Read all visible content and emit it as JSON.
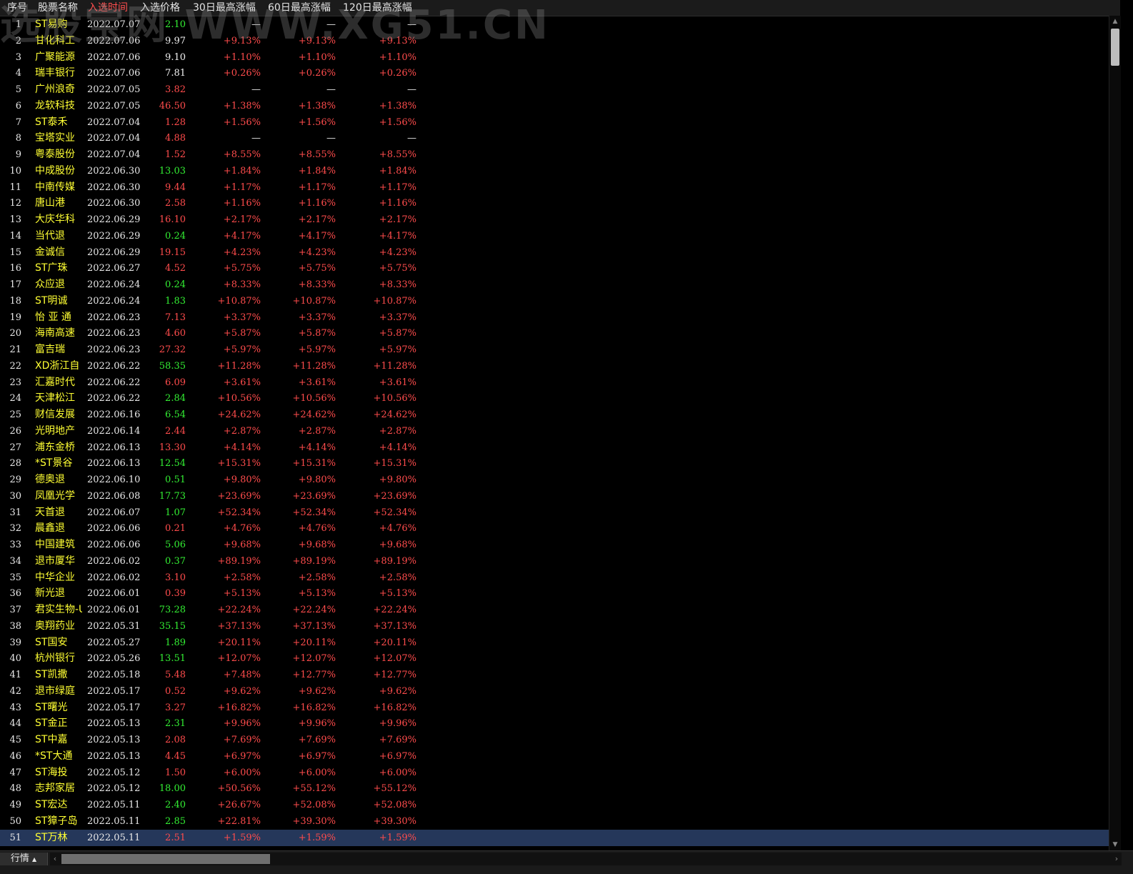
{
  "header": {
    "columns": [
      "序号",
      "股票名称",
      "入选时间",
      "入选价格",
      "30日最高涨幅",
      "60日最高涨幅",
      "120日最高涨幅"
    ],
    "active_column": "入选时间"
  },
  "watermark": "选股宝网 WWW.XG51.CN",
  "colors": {
    "up": "#ff4c4c",
    "down": "#33ee33",
    "name": "#ffff33",
    "selected_row": "#25375a"
  },
  "rows": [
    {
      "seq": "1",
      "name": "ST易购",
      "date": "2022.07.07",
      "price": "2.10",
      "pc": "green",
      "g30": "—",
      "g60": "—",
      "g120": "—"
    },
    {
      "seq": "2",
      "name": "甘化科工",
      "date": "2022.07.06",
      "price": "9.97",
      "pc": "white",
      "g30": "+9.13%",
      "g60": "+9.13%",
      "g120": "+9.13%"
    },
    {
      "seq": "3",
      "name": "广聚能源",
      "date": "2022.07.06",
      "price": "9.10",
      "pc": "white",
      "g30": "+1.10%",
      "g60": "+1.10%",
      "g120": "+1.10%"
    },
    {
      "seq": "4",
      "name": "瑞丰银行",
      "date": "2022.07.06",
      "price": "7.81",
      "pc": "white",
      "g30": "+0.26%",
      "g60": "+0.26%",
      "g120": "+0.26%"
    },
    {
      "seq": "5",
      "name": "广州浪奇",
      "date": "2022.07.05",
      "price": "3.82",
      "pc": "red",
      "g30": "—",
      "g60": "—",
      "g120": "—"
    },
    {
      "seq": "6",
      "name": "龙软科技",
      "date": "2022.07.05",
      "price": "46.50",
      "pc": "red",
      "g30": "+1.38%",
      "g60": "+1.38%",
      "g120": "+1.38%"
    },
    {
      "seq": "7",
      "name": "ST泰禾",
      "date": "2022.07.04",
      "price": "1.28",
      "pc": "red",
      "g30": "+1.56%",
      "g60": "+1.56%",
      "g120": "+1.56%"
    },
    {
      "seq": "8",
      "name": "宝塔实业",
      "date": "2022.07.04",
      "price": "4.88",
      "pc": "red",
      "g30": "—",
      "g60": "—",
      "g120": "—"
    },
    {
      "seq": "9",
      "name": "粤泰股份",
      "date": "2022.07.04",
      "price": "1.52",
      "pc": "red",
      "g30": "+8.55%",
      "g60": "+8.55%",
      "g120": "+8.55%"
    },
    {
      "seq": "10",
      "name": "中成股份",
      "date": "2022.06.30",
      "price": "13.03",
      "pc": "green",
      "g30": "+1.84%",
      "g60": "+1.84%",
      "g120": "+1.84%"
    },
    {
      "seq": "11",
      "name": "中南传媒",
      "date": "2022.06.30",
      "price": "9.44",
      "pc": "red",
      "g30": "+1.17%",
      "g60": "+1.17%",
      "g120": "+1.17%"
    },
    {
      "seq": "12",
      "name": "唐山港",
      "date": "2022.06.30",
      "price": "2.58",
      "pc": "red",
      "g30": "+1.16%",
      "g60": "+1.16%",
      "g120": "+1.16%"
    },
    {
      "seq": "13",
      "name": "大庆华科",
      "date": "2022.06.29",
      "price": "16.10",
      "pc": "red",
      "g30": "+2.17%",
      "g60": "+2.17%",
      "g120": "+2.17%"
    },
    {
      "seq": "14",
      "name": "当代退",
      "date": "2022.06.29",
      "price": "0.24",
      "pc": "green",
      "g30": "+4.17%",
      "g60": "+4.17%",
      "g120": "+4.17%"
    },
    {
      "seq": "15",
      "name": "金诚信",
      "date": "2022.06.29",
      "price": "19.15",
      "pc": "red",
      "g30": "+4.23%",
      "g60": "+4.23%",
      "g120": "+4.23%"
    },
    {
      "seq": "16",
      "name": "ST广珠",
      "date": "2022.06.27",
      "price": "4.52",
      "pc": "red",
      "g30": "+5.75%",
      "g60": "+5.75%",
      "g120": "+5.75%"
    },
    {
      "seq": "17",
      "name": "众应退",
      "date": "2022.06.24",
      "price": "0.24",
      "pc": "green",
      "g30": "+8.33%",
      "g60": "+8.33%",
      "g120": "+8.33%"
    },
    {
      "seq": "18",
      "name": "ST明诚",
      "date": "2022.06.24",
      "price": "1.83",
      "pc": "green",
      "g30": "+10.87%",
      "g60": "+10.87%",
      "g120": "+10.87%"
    },
    {
      "seq": "19",
      "name": "怡 亚 通",
      "date": "2022.06.23",
      "price": "7.13",
      "pc": "red",
      "g30": "+3.37%",
      "g60": "+3.37%",
      "g120": "+3.37%"
    },
    {
      "seq": "20",
      "name": "海南高速",
      "date": "2022.06.23",
      "price": "4.60",
      "pc": "red",
      "g30": "+5.87%",
      "g60": "+5.87%",
      "g120": "+5.87%"
    },
    {
      "seq": "21",
      "name": "富吉瑞",
      "date": "2022.06.23",
      "price": "27.32",
      "pc": "red",
      "g30": "+5.97%",
      "g60": "+5.97%",
      "g120": "+5.97%"
    },
    {
      "seq": "22",
      "name": "XD浙江自",
      "date": "2022.06.22",
      "price": "58.35",
      "pc": "green",
      "g30": "+11.28%",
      "g60": "+11.28%",
      "g120": "+11.28%"
    },
    {
      "seq": "23",
      "name": "汇嘉时代",
      "date": "2022.06.22",
      "price": "6.09",
      "pc": "red",
      "g30": "+3.61%",
      "g60": "+3.61%",
      "g120": "+3.61%"
    },
    {
      "seq": "24",
      "name": "天津松江",
      "date": "2022.06.22",
      "price": "2.84",
      "pc": "green",
      "g30": "+10.56%",
      "g60": "+10.56%",
      "g120": "+10.56%"
    },
    {
      "seq": "25",
      "name": "财信发展",
      "date": "2022.06.16",
      "price": "6.54",
      "pc": "green",
      "g30": "+24.62%",
      "g60": "+24.62%",
      "g120": "+24.62%"
    },
    {
      "seq": "26",
      "name": "光明地产",
      "date": "2022.06.14",
      "price": "2.44",
      "pc": "red",
      "g30": "+2.87%",
      "g60": "+2.87%",
      "g120": "+2.87%"
    },
    {
      "seq": "27",
      "name": "浦东金桥",
      "date": "2022.06.13",
      "price": "13.30",
      "pc": "red",
      "g30": "+4.14%",
      "g60": "+4.14%",
      "g120": "+4.14%"
    },
    {
      "seq": "28",
      "name": "*ST景谷",
      "date": "2022.06.13",
      "price": "12.54",
      "pc": "green",
      "g30": "+15.31%",
      "g60": "+15.31%",
      "g120": "+15.31%"
    },
    {
      "seq": "29",
      "name": "德奥退",
      "date": "2022.06.10",
      "price": "0.51",
      "pc": "green",
      "g30": "+9.80%",
      "g60": "+9.80%",
      "g120": "+9.80%"
    },
    {
      "seq": "30",
      "name": "凤凰光学",
      "date": "2022.06.08",
      "price": "17.73",
      "pc": "green",
      "g30": "+23.69%",
      "g60": "+23.69%",
      "g120": "+23.69%"
    },
    {
      "seq": "31",
      "name": "天首退",
      "date": "2022.06.07",
      "price": "1.07",
      "pc": "green",
      "g30": "+52.34%",
      "g60": "+52.34%",
      "g120": "+52.34%"
    },
    {
      "seq": "32",
      "name": "晨鑫退",
      "date": "2022.06.06",
      "price": "0.21",
      "pc": "red",
      "g30": "+4.76%",
      "g60": "+4.76%",
      "g120": "+4.76%"
    },
    {
      "seq": "33",
      "name": "中国建筑",
      "date": "2022.06.06",
      "price": "5.06",
      "pc": "green",
      "g30": "+9.68%",
      "g60": "+9.68%",
      "g120": "+9.68%"
    },
    {
      "seq": "34",
      "name": "退市厦华",
      "date": "2022.06.02",
      "price": "0.37",
      "pc": "green",
      "g30": "+89.19%",
      "g60": "+89.19%",
      "g120": "+89.19%"
    },
    {
      "seq": "35",
      "name": "中华企业",
      "date": "2022.06.02",
      "price": "3.10",
      "pc": "red",
      "g30": "+2.58%",
      "g60": "+2.58%",
      "g120": "+2.58%"
    },
    {
      "seq": "36",
      "name": "新光退",
      "date": "2022.06.01",
      "price": "0.39",
      "pc": "red",
      "g30": "+5.13%",
      "g60": "+5.13%",
      "g120": "+5.13%"
    },
    {
      "seq": "37",
      "name": "君实生物-U",
      "date": "2022.06.01",
      "price": "73.28",
      "pc": "green",
      "g30": "+22.24%",
      "g60": "+22.24%",
      "g120": "+22.24%"
    },
    {
      "seq": "38",
      "name": "奥翔药业",
      "date": "2022.05.31",
      "price": "35.15",
      "pc": "green",
      "g30": "+37.13%",
      "g60": "+37.13%",
      "g120": "+37.13%"
    },
    {
      "seq": "39",
      "name": "ST国安",
      "date": "2022.05.27",
      "price": "1.89",
      "pc": "green",
      "g30": "+20.11%",
      "g60": "+20.11%",
      "g120": "+20.11%"
    },
    {
      "seq": "40",
      "name": "杭州银行",
      "date": "2022.05.26",
      "price": "13.51",
      "pc": "green",
      "g30": "+12.07%",
      "g60": "+12.07%",
      "g120": "+12.07%"
    },
    {
      "seq": "41",
      "name": "ST凯撒",
      "date": "2022.05.18",
      "price": "5.48",
      "pc": "red",
      "g30": "+7.48%",
      "g60": "+12.77%",
      "g120": "+12.77%"
    },
    {
      "seq": "42",
      "name": "退市绿庭",
      "date": "2022.05.17",
      "price": "0.52",
      "pc": "red",
      "g30": "+9.62%",
      "g60": "+9.62%",
      "g120": "+9.62%"
    },
    {
      "seq": "43",
      "name": "ST曙光",
      "date": "2022.05.17",
      "price": "3.27",
      "pc": "red",
      "g30": "+16.82%",
      "g60": "+16.82%",
      "g120": "+16.82%"
    },
    {
      "seq": "44",
      "name": "ST金正",
      "date": "2022.05.13",
      "price": "2.31",
      "pc": "green",
      "g30": "+9.96%",
      "g60": "+9.96%",
      "g120": "+9.96%"
    },
    {
      "seq": "45",
      "name": "ST中嘉",
      "date": "2022.05.13",
      "price": "2.08",
      "pc": "red",
      "g30": "+7.69%",
      "g60": "+7.69%",
      "g120": "+7.69%"
    },
    {
      "seq": "46",
      "name": "*ST大通",
      "date": "2022.05.13",
      "price": "4.45",
      "pc": "red",
      "g30": "+6.97%",
      "g60": "+6.97%",
      "g120": "+6.97%"
    },
    {
      "seq": "47",
      "name": "ST海投",
      "date": "2022.05.12",
      "price": "1.50",
      "pc": "red",
      "g30": "+6.00%",
      "g60": "+6.00%",
      "g120": "+6.00%"
    },
    {
      "seq": "48",
      "name": "志邦家居",
      "date": "2022.05.12",
      "price": "18.00",
      "pc": "green",
      "g30": "+50.56%",
      "g60": "+55.12%",
      "g120": "+55.12%"
    },
    {
      "seq": "49",
      "name": "ST宏达",
      "date": "2022.05.11",
      "price": "2.40",
      "pc": "green",
      "g30": "+26.67%",
      "g60": "+52.08%",
      "g120": "+52.08%"
    },
    {
      "seq": "50",
      "name": "ST獐子岛",
      "date": "2022.05.11",
      "price": "2.85",
      "pc": "green",
      "g30": "+22.81%",
      "g60": "+39.30%",
      "g120": "+39.30%"
    },
    {
      "seq": "51",
      "name": "ST万林",
      "date": "2022.05.11",
      "price": "2.51",
      "pc": "red",
      "g30": "+1.59%",
      "g60": "+1.59%",
      "g120": "+1.59%",
      "selected": true
    }
  ],
  "bottom": {
    "tab_label": "行情",
    "tab_icon": "caret-up-icon",
    "scroll_left_icon": "chevron-left-icon"
  }
}
